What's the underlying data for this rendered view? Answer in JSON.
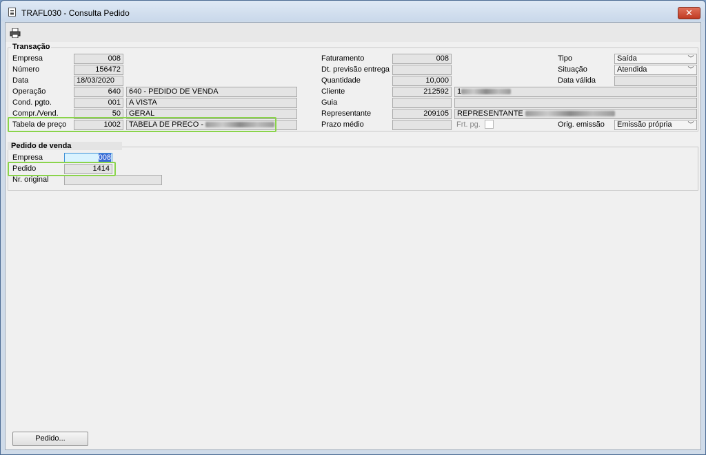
{
  "window": {
    "title": "TRAFL030 - Consulta Pedido",
    "close_symbol": "✕"
  },
  "transacao": {
    "title": "Transação",
    "empresa_label": "Empresa",
    "empresa": "008",
    "numero_label": "Número",
    "numero": "156472",
    "data_label": "Data",
    "data": "18/03/2020",
    "operacao_label": "Operação",
    "operacao_code": "640",
    "operacao_desc": "640 - PEDIDO DE VENDA",
    "cond_label": "Cond. pgto.",
    "cond_code": "001",
    "cond_desc": "A VISTA",
    "compr_label": "Compr./Vend.",
    "compr_code": "50",
    "compr_desc": "GERAL",
    "tabela_label": "Tabela de preço",
    "tabela_code": "1002",
    "tabela_desc": "TABELA DE PRECO -",
    "faturamento_label": "Faturamento",
    "faturamento": "008",
    "dtprev_label": "Dt. previsão entrega",
    "dtprev": "",
    "quantidade_label": "Quantidade",
    "quantidade": "10,000",
    "cliente_label": "Cliente",
    "cliente_code": "212592",
    "cliente_desc": "1",
    "guia_label": "Guia",
    "guia": "",
    "representante_label": "Representante",
    "representante_code": "209105",
    "representante_desc": "REPRESENTANTE",
    "prazo_label": "Prazo médio",
    "prazo": "",
    "frt_label": "Frt. pg.",
    "tipo_label": "Tipo",
    "tipo": "Saída",
    "situacao_label": "Situação",
    "situacao": "Atendida",
    "datavalida_label": "Data válida",
    "datavalida": "",
    "origem_label": "Orig. emissão",
    "origem": "Emissão própria"
  },
  "pedido_venda": {
    "title": "Pedido de venda",
    "empresa_label": "Empresa",
    "empresa": "008",
    "pedido_label": "Pedido",
    "pedido": "1414",
    "nr_original_label": "Nr. original",
    "nr_original": ""
  },
  "buttons": {
    "pedido": "Pedido..."
  },
  "icons": {
    "window": "document-icon",
    "print": "printer-icon",
    "dropdown": "chevron-down-icon"
  },
  "colors": {
    "highlight": "#8ad44b",
    "close": "#c03a22",
    "focus_bg": "#d9f3ff"
  }
}
